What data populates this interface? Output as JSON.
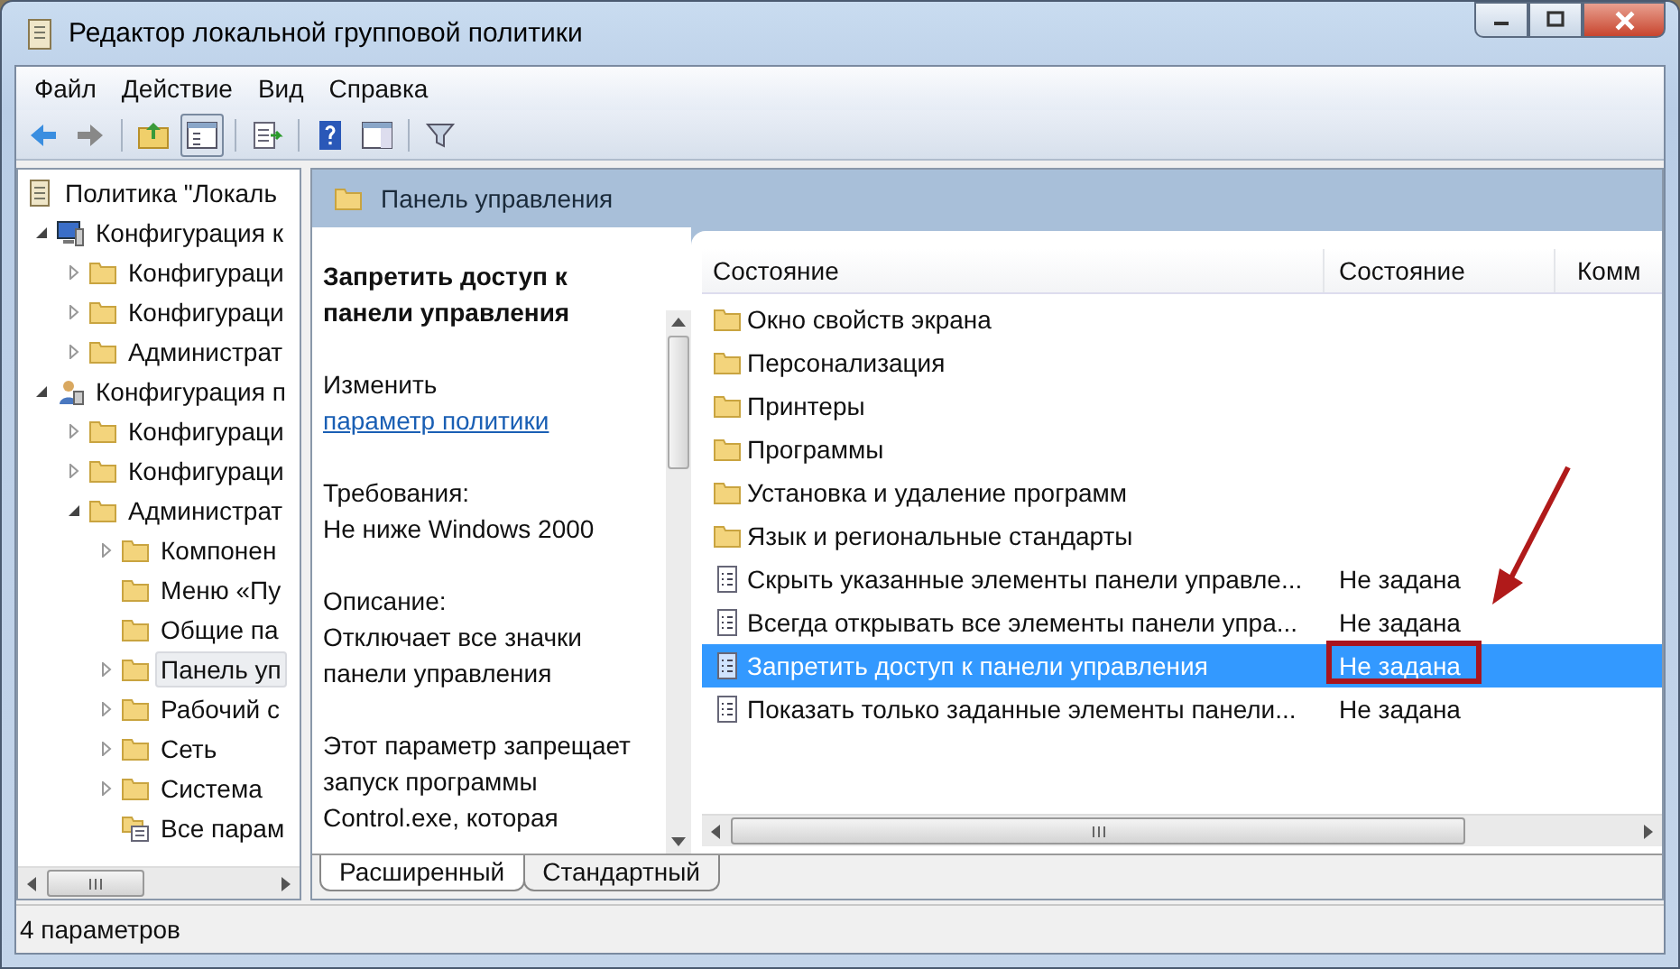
{
  "window": {
    "title": "Редактор локальной групповой политики"
  },
  "menu": [
    "Файл",
    "Действие",
    "Вид",
    "Справка"
  ],
  "tree": {
    "label": "Политика \"Локаль",
    "kind": "policy",
    "children": [
      {
        "label": "Конфигурация к",
        "kind": "computer",
        "expanded": true,
        "selected": false,
        "children": [
          {
            "label": "Конфигураци",
            "kind": "folder",
            "expanded": false,
            "selected": false
          },
          {
            "label": "Конфигураци",
            "kind": "folder",
            "expanded": false,
            "selected": false
          },
          {
            "label": "Администрат",
            "kind": "folder",
            "expanded": false,
            "selected": false
          }
        ]
      },
      {
        "label": "Конфигурация п",
        "kind": "user",
        "expanded": true,
        "selected": false,
        "children": [
          {
            "label": "Конфигураци",
            "kind": "folder",
            "expanded": false,
            "selected": false
          },
          {
            "label": "Конфигураци",
            "kind": "folder",
            "expanded": false,
            "selected": false
          },
          {
            "label": "Администрат",
            "kind": "folder",
            "expanded": true,
            "selected": false,
            "children": [
              {
                "label": "Компонен",
                "kind": "folder",
                "expanded": false,
                "selected": false
              },
              {
                "label": "Меню «Пу",
                "kind": "folder",
                "selected": false
              },
              {
                "label": "Общие па",
                "kind": "folder",
                "selected": false
              },
              {
                "label": "Панель уп",
                "kind": "folder",
                "expanded": false,
                "selected": true
              },
              {
                "label": "Рабочий с",
                "kind": "folder",
                "expanded": false,
                "selected": false
              },
              {
                "label": "Сеть",
                "kind": "folder",
                "expanded": false,
                "selected": false
              },
              {
                "label": "Система",
                "kind": "folder",
                "expanded": false,
                "selected": false
              },
              {
                "label": "Все парам",
                "kind": "all-settings",
                "selected": false
              }
            ]
          }
        ]
      }
    ]
  },
  "panel": {
    "title": "Панель управления"
  },
  "description": {
    "heading": "Запретить доступ к панели управления",
    "edit_prefix": "Изменить",
    "edit_link": "параметр политики",
    "requirements_label": "Требования:",
    "requirements": "Не ниже Windows 2000",
    "description_label": "Описание:",
    "description": "Отключает все значки панели управления",
    "details": "Этот параметр запрещает запуск программы Control.exe, которая"
  },
  "table": {
    "columns": [
      "Состояние",
      "Состояние",
      "Комм"
    ],
    "rows": [
      {
        "kind": "folder",
        "name": "Окно свойств экрана",
        "selected": false,
        "highlighted": false
      },
      {
        "kind": "folder",
        "name": "Персонализация",
        "selected": false,
        "highlighted": false
      },
      {
        "kind": "folder",
        "name": "Принтеры",
        "selected": false,
        "highlighted": false
      },
      {
        "kind": "folder",
        "name": "Программы",
        "selected": false,
        "highlighted": false
      },
      {
        "kind": "folder",
        "name": "Установка и удаление программ",
        "selected": false,
        "highlighted": false
      },
      {
        "kind": "folder",
        "name": "Язык и региональные стандарты",
        "selected": false,
        "highlighted": false
      },
      {
        "kind": "setting",
        "name": "Скрыть указанные элементы панели управле...",
        "state": "Не задана",
        "selected": false,
        "highlighted": false
      },
      {
        "kind": "setting",
        "name": "Всегда открывать все элементы панели упра...",
        "state": "Не задана",
        "selected": false,
        "highlighted": false
      },
      {
        "kind": "setting",
        "name": "Запретить доступ к панели управления",
        "state": "Не задана",
        "selected": true,
        "highlighted": true
      },
      {
        "kind": "setting",
        "name": "Показать только заданные элементы панели...",
        "state": "Не задана",
        "selected": false,
        "highlighted": false
      }
    ]
  },
  "view_tabs": [
    {
      "label": "Расширенный",
      "selected": true
    },
    {
      "label": "Стандартный",
      "selected": false
    }
  ],
  "status_bar": "4 параметров"
}
